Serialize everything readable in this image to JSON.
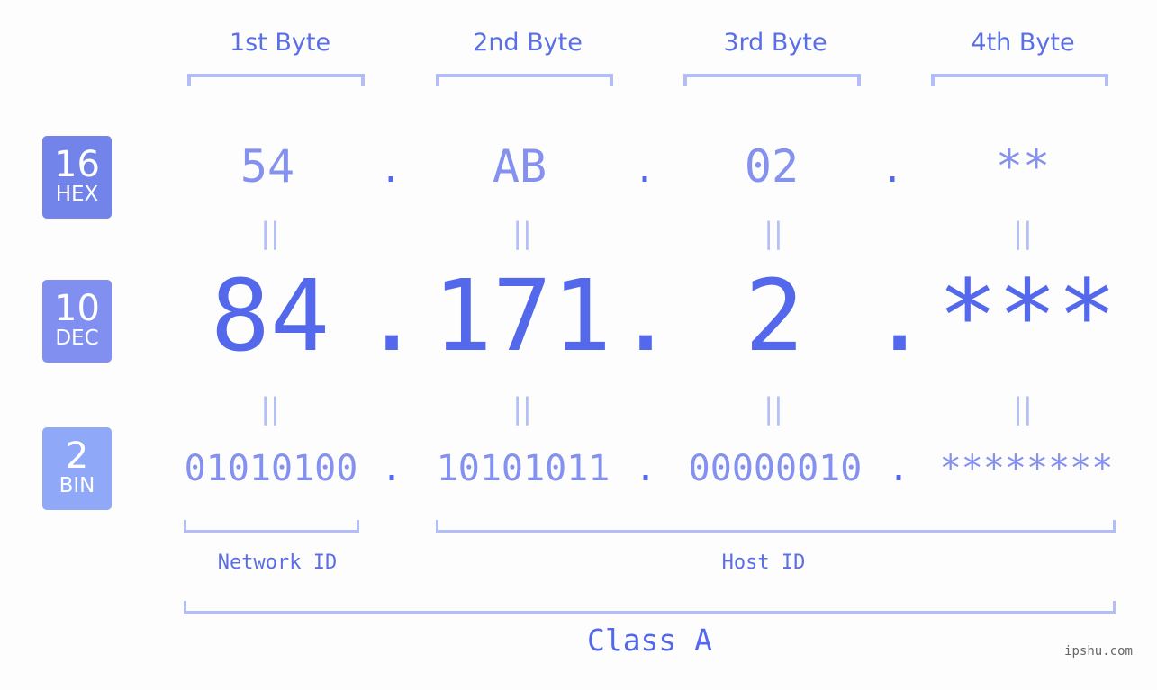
{
  "colors": {
    "accent": "#5468ec",
    "light_value": "#8491ee",
    "bracket": "#b3bdf8",
    "badge_hex": "#7283ea",
    "badge_dec": "#8190f0",
    "badge_bin": "#8fa8f8",
    "background": "#fcfdfc"
  },
  "byte_headers": [
    "1st Byte",
    "2nd Byte",
    "3rd Byte",
    "4th Byte"
  ],
  "rows": {
    "hex": {
      "badge_number": "16",
      "badge_label": "HEX",
      "values": [
        "54",
        "AB",
        "02",
        "**"
      ]
    },
    "dec": {
      "badge_number": "10",
      "badge_label": "DEC",
      "values": [
        "84",
        "171",
        "2",
        "***"
      ]
    },
    "bin": {
      "badge_number": "2",
      "badge_label": "BIN",
      "values": [
        "01010100",
        "10101011",
        "00000010",
        "********"
      ]
    }
  },
  "separator": ".",
  "equals_symbol": "||",
  "segments": {
    "network_id": "Network ID",
    "host_id": "Host ID",
    "class": "Class A"
  },
  "watermark": "ipshu.com"
}
